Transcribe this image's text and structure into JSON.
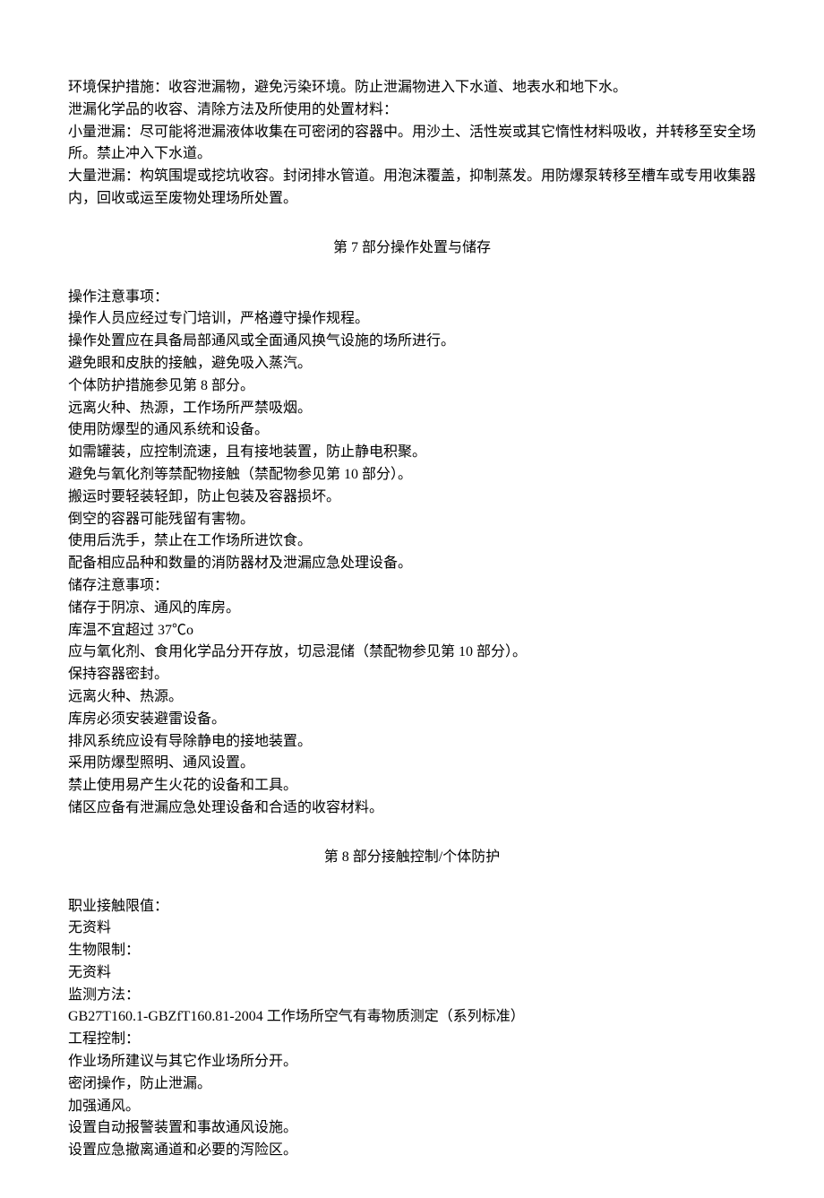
{
  "intro": {
    "p1": "环境保护措施：收容泄漏物，避免污染环境。防止泄漏物进入下水道、地表水和地下水。",
    "p2": "泄漏化学品的收容、清除方法及所使用的处置材料：",
    "p3": "小量泄漏：尽可能将泄漏液体收集在可密闭的容器中。用沙土、活性炭或其它惰性材料吸收，并转移至安全场所。禁止冲入下水道。",
    "p4": "大量泄漏：构筑围堤或挖坑收容。封闭排水管道。用泡沫覆盖，抑制蒸发。用防爆泵转移至槽车或专用收集器内，回收或运至废物处理场所处置。"
  },
  "section7": {
    "title": "第 7 部分操作处置与储存",
    "lines": [
      "操作注意事项：",
      "操作人员应经过专门培训，严格遵守操作规程。",
      "操作处置应在具备局部通风或全面通风换气设施的场所进行。",
      "避免眼和皮肤的接触，避免吸入蒸汽。",
      "个体防护措施参见第 8 部分。",
      "远离火种、热源，工作场所严禁吸烟。",
      "使用防爆型的通风系统和设备。",
      "如需罐装，应控制流速，且有接地装置，防止静电积聚。",
      "避免与氧化剂等禁配物接触（禁配物参见第 10 部分）。",
      "搬运时要轻装轻卸，防止包装及容器损坏。",
      "倒空的容器可能残留有害物。",
      "使用后洗手，禁止在工作场所进饮食。",
      "配备相应品种和数量的消防器材及泄漏应急处理设备。",
      "储存注意事项：",
      "储存于阴凉、通风的库房。",
      "库温不宜超过 37℃o",
      "应与氧化剂、食用化学品分开存放，切忌混储（禁配物参见第 10 部分）。",
      "保持容器密封。",
      "远离火种、热源。",
      "库房必须安装避雷设备。",
      "排风系统应设有导除静电的接地装置。",
      "采用防爆型照明、通风设置。",
      "禁止使用易产生火花的设备和工具。",
      "储区应备有泄漏应急处理设备和合适的收容材料。"
    ]
  },
  "section8": {
    "title": "第 8 部分接触控制/个体防护",
    "lines": [
      "职业接触限值：",
      "无资料",
      "生物限制：",
      "无资料",
      "监测方法：",
      "GB27T160.1-GBZfT160.81-2004 工作场所空气有毒物质测定（系列标准）",
      "工程控制：",
      "作业场所建议与其它作业场所分开。",
      "密闭操作，防止泄漏。",
      "加强通风。",
      "设置自动报警装置和事故通风设施。",
      "设置应急撤离通道和必要的泻险区。"
    ]
  }
}
